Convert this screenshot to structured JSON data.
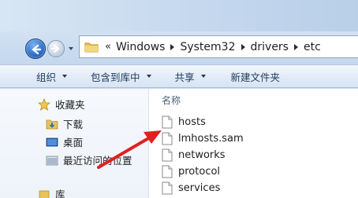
{
  "address_bar": {
    "overflow_chevron": "«",
    "crumbs": [
      "Windows",
      "System32",
      "drivers",
      "etc"
    ]
  },
  "toolbar": {
    "organize": "组织",
    "include_in_library": "包含到库中",
    "share": "共享",
    "new_folder": "新建文件夹"
  },
  "navigation_pane": {
    "favorites": "收藏夹",
    "downloads": "下载",
    "desktop": "桌面",
    "recent_places": "最近访问的位置",
    "libraries": "库"
  },
  "file_list": {
    "column_name": "名称",
    "files": [
      "hosts",
      "lmhosts.sam",
      "networks",
      "protocol",
      "services"
    ]
  },
  "annotation": {
    "arrow_color": "#e02020"
  },
  "colors": {
    "chrome": "#c9dbef",
    "toolbar_text": "#1e395b",
    "header_text": "#4c607a"
  }
}
